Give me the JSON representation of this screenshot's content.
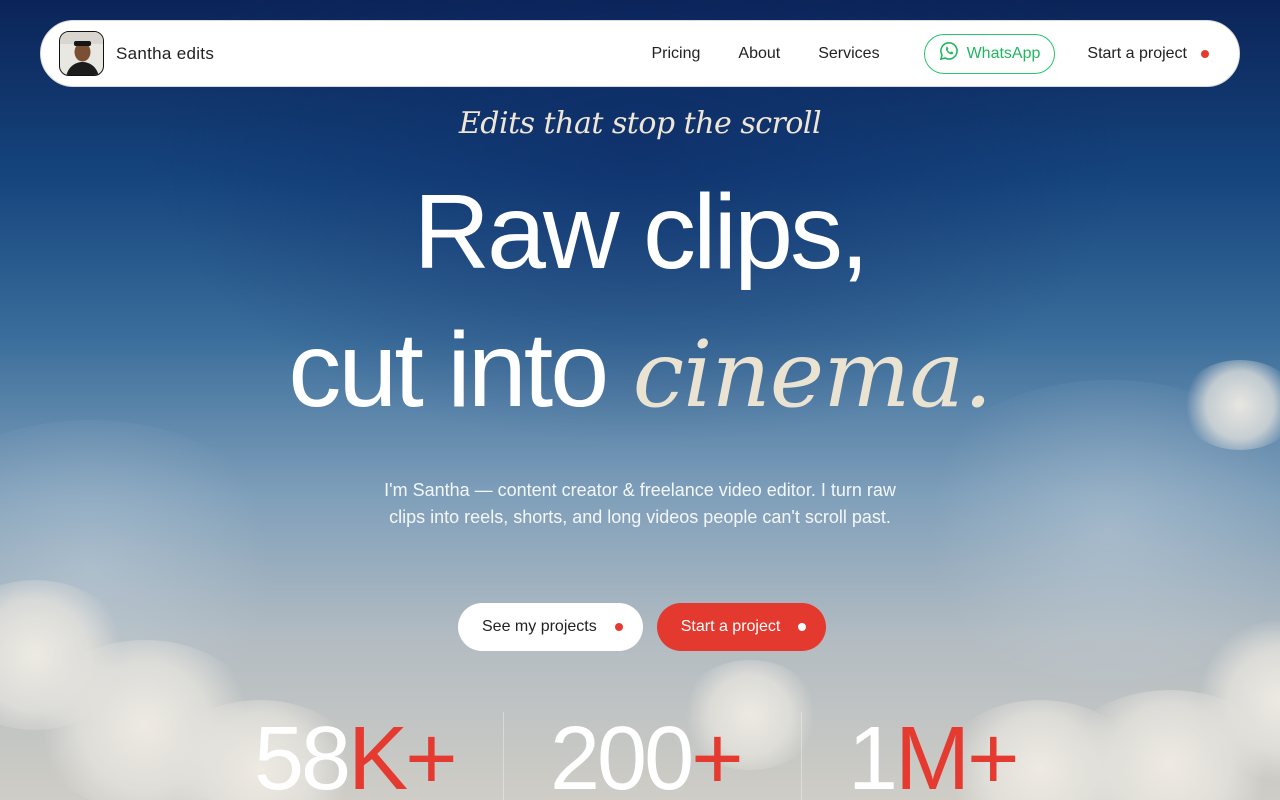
{
  "nav": {
    "brand": "Santha edits",
    "links": [
      {
        "label": "Pricing"
      },
      {
        "label": "About"
      },
      {
        "label": "Services"
      }
    ],
    "whatsapp_label": "WhatsApp",
    "cta_label": "Start a project"
  },
  "hero": {
    "tagline": "Edits that stop the scroll",
    "headline_line1": "Raw clips,",
    "headline_line2_plain": "cut into",
    "headline_line2_script": "cinema.",
    "subtitle": "I'm Santha — content creator & freelance video editor. I turn raw clips into reels, shorts, and long videos people can't scroll past.",
    "primary_button": "See my projects",
    "secondary_button": "Start a project"
  },
  "stats": [
    {
      "number": "58",
      "suffix": "K+"
    },
    {
      "number": "200",
      "suffix": "+"
    },
    {
      "number": "1",
      "suffix": "M+"
    }
  ],
  "colors": {
    "accent": "#e3392f",
    "whatsapp": "#25c26a"
  }
}
